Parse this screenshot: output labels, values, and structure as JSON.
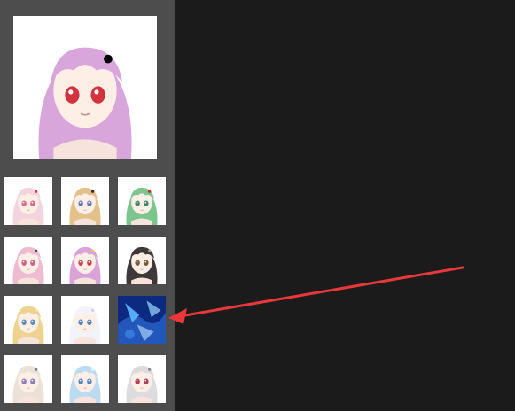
{
  "app": {
    "background_color": "#1b1b1b",
    "sidebar_color": "#4d4d4d"
  },
  "preview": {
    "icon": "anime-portrait-image",
    "hair": "#d9a6dc",
    "eyes": "#d5323f",
    "background": "#ffffff"
  },
  "thumbnails": [
    {
      "icon": "anime-portrait-thumbnail",
      "hair": "#f3d3dd",
      "eyes": "#e0698a",
      "bg": "#ffffff",
      "accent": "#d23a4a"
    },
    {
      "icon": "anime-portrait-thumbnail",
      "hair": "#e4c08b",
      "eyes": "#6a74b8",
      "bg": "#ffffff",
      "accent": "#2a2a2a"
    },
    {
      "icon": "anime-portrait-thumbnail",
      "hair": "#7cc58e",
      "eyes": "#3a8c6b",
      "bg": "#ffffff",
      "accent": "#cf2530"
    },
    {
      "icon": "anime-portrait-thumbnail",
      "hair": "#efbbd1",
      "eyes": "#d05d8e",
      "bg": "#ffffff",
      "accent": "#4c4c6e"
    },
    {
      "icon": "anime-portrait-thumbnail",
      "hair": "#d9a3d7",
      "eyes": "#cf3a56",
      "bg": "#ffffff",
      "accent": "#f0c850"
    },
    {
      "icon": "anime-portrait-thumbnail",
      "hair": "#3f3838",
      "eyes": "#7a5a3a",
      "bg": "#ffffff",
      "accent": "#9a9a9a"
    },
    {
      "icon": "anime-portrait-thumbnail",
      "hair": "#eed290",
      "eyes": "#5a8cb8",
      "bg": "#ffffff",
      "accent": "#f5dfb0"
    },
    {
      "icon": "anime-portrait-thumbnail",
      "hair": "#f2f4fa",
      "eyes": "#4e7fc8",
      "bg": "#ffffff",
      "accent": "#c9d4ea"
    },
    {
      "icon": "glitched-blue-image-thumbnail",
      "hair": "#2b63c9",
      "eyes": "#9fd8ff",
      "bg": "#0a1f66",
      "accent": "#5fb8ff"
    },
    {
      "icon": "anime-portrait-thumbnail",
      "hair": "#ece1d6",
      "eyes": "#8e7cb4",
      "bg": "#ffffff",
      "accent": "#7c7c7c"
    },
    {
      "icon": "anime-portrait-thumbnail",
      "hair": "#bcdaf0",
      "eyes": "#4d86c2",
      "bg": "#ffffff",
      "accent": "#e8f2fa"
    },
    {
      "icon": "anime-portrait-thumbnail",
      "hair": "#dcdcdf",
      "eyes": "#b0405a",
      "bg": "#ffffff",
      "accent": "#8a8a8f"
    }
  ],
  "annotation": {
    "icon": "red-arrow-icon",
    "color": "#e8383b"
  }
}
